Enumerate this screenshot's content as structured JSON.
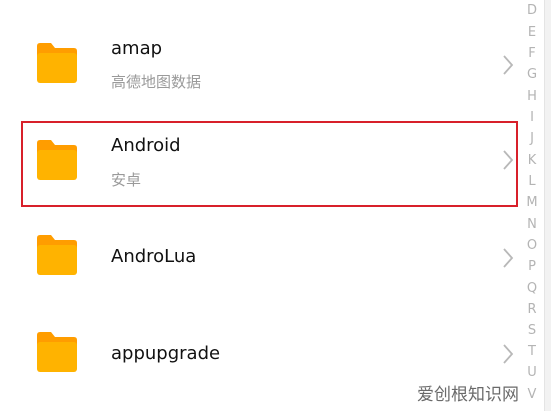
{
  "folders": [
    {
      "name": "amap",
      "description": "高德地图数据"
    },
    {
      "name": "Android",
      "description": "安卓"
    },
    {
      "name": "AndroLua",
      "description": ""
    },
    {
      "name": "appupgrade",
      "description": ""
    }
  ],
  "index_letters": [
    "D",
    "E",
    "F",
    "G",
    "H",
    "I",
    "J",
    "K",
    "L",
    "M",
    "N",
    "O",
    "P",
    "Q",
    "R",
    "S",
    "T",
    "U",
    "V"
  ],
  "watermark": "爱创根知识网",
  "colors": {
    "folder": "#ffb300",
    "folder_dark": "#ff9d00",
    "highlight_border": "#d8202a",
    "title": "#111111",
    "subtitle": "#9a9a9a",
    "index_letter": "#b4b4b4"
  },
  "icons": {
    "folder": "folder-icon",
    "chevron": "chevron-right-icon"
  }
}
